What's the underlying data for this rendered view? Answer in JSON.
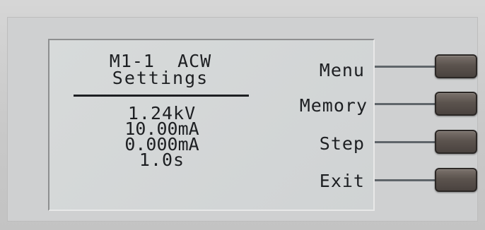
{
  "screen": {
    "mode_line": "M1-1  ACW",
    "page_title": "Settings",
    "values": [
      "1.24kV",
      "10.00mA",
      "0.000mA",
      "1.0s"
    ]
  },
  "softkeys": [
    {
      "label": "Menu"
    },
    {
      "label": "Memory"
    },
    {
      "label": "Step"
    },
    {
      "label": "Exit"
    }
  ],
  "colors": {
    "panel": "#cdcdcd",
    "lcd_background": "#d3d6d7",
    "lcd_text": "#1d1f22",
    "button": "#5b534e",
    "connector": "#5f656a"
  }
}
